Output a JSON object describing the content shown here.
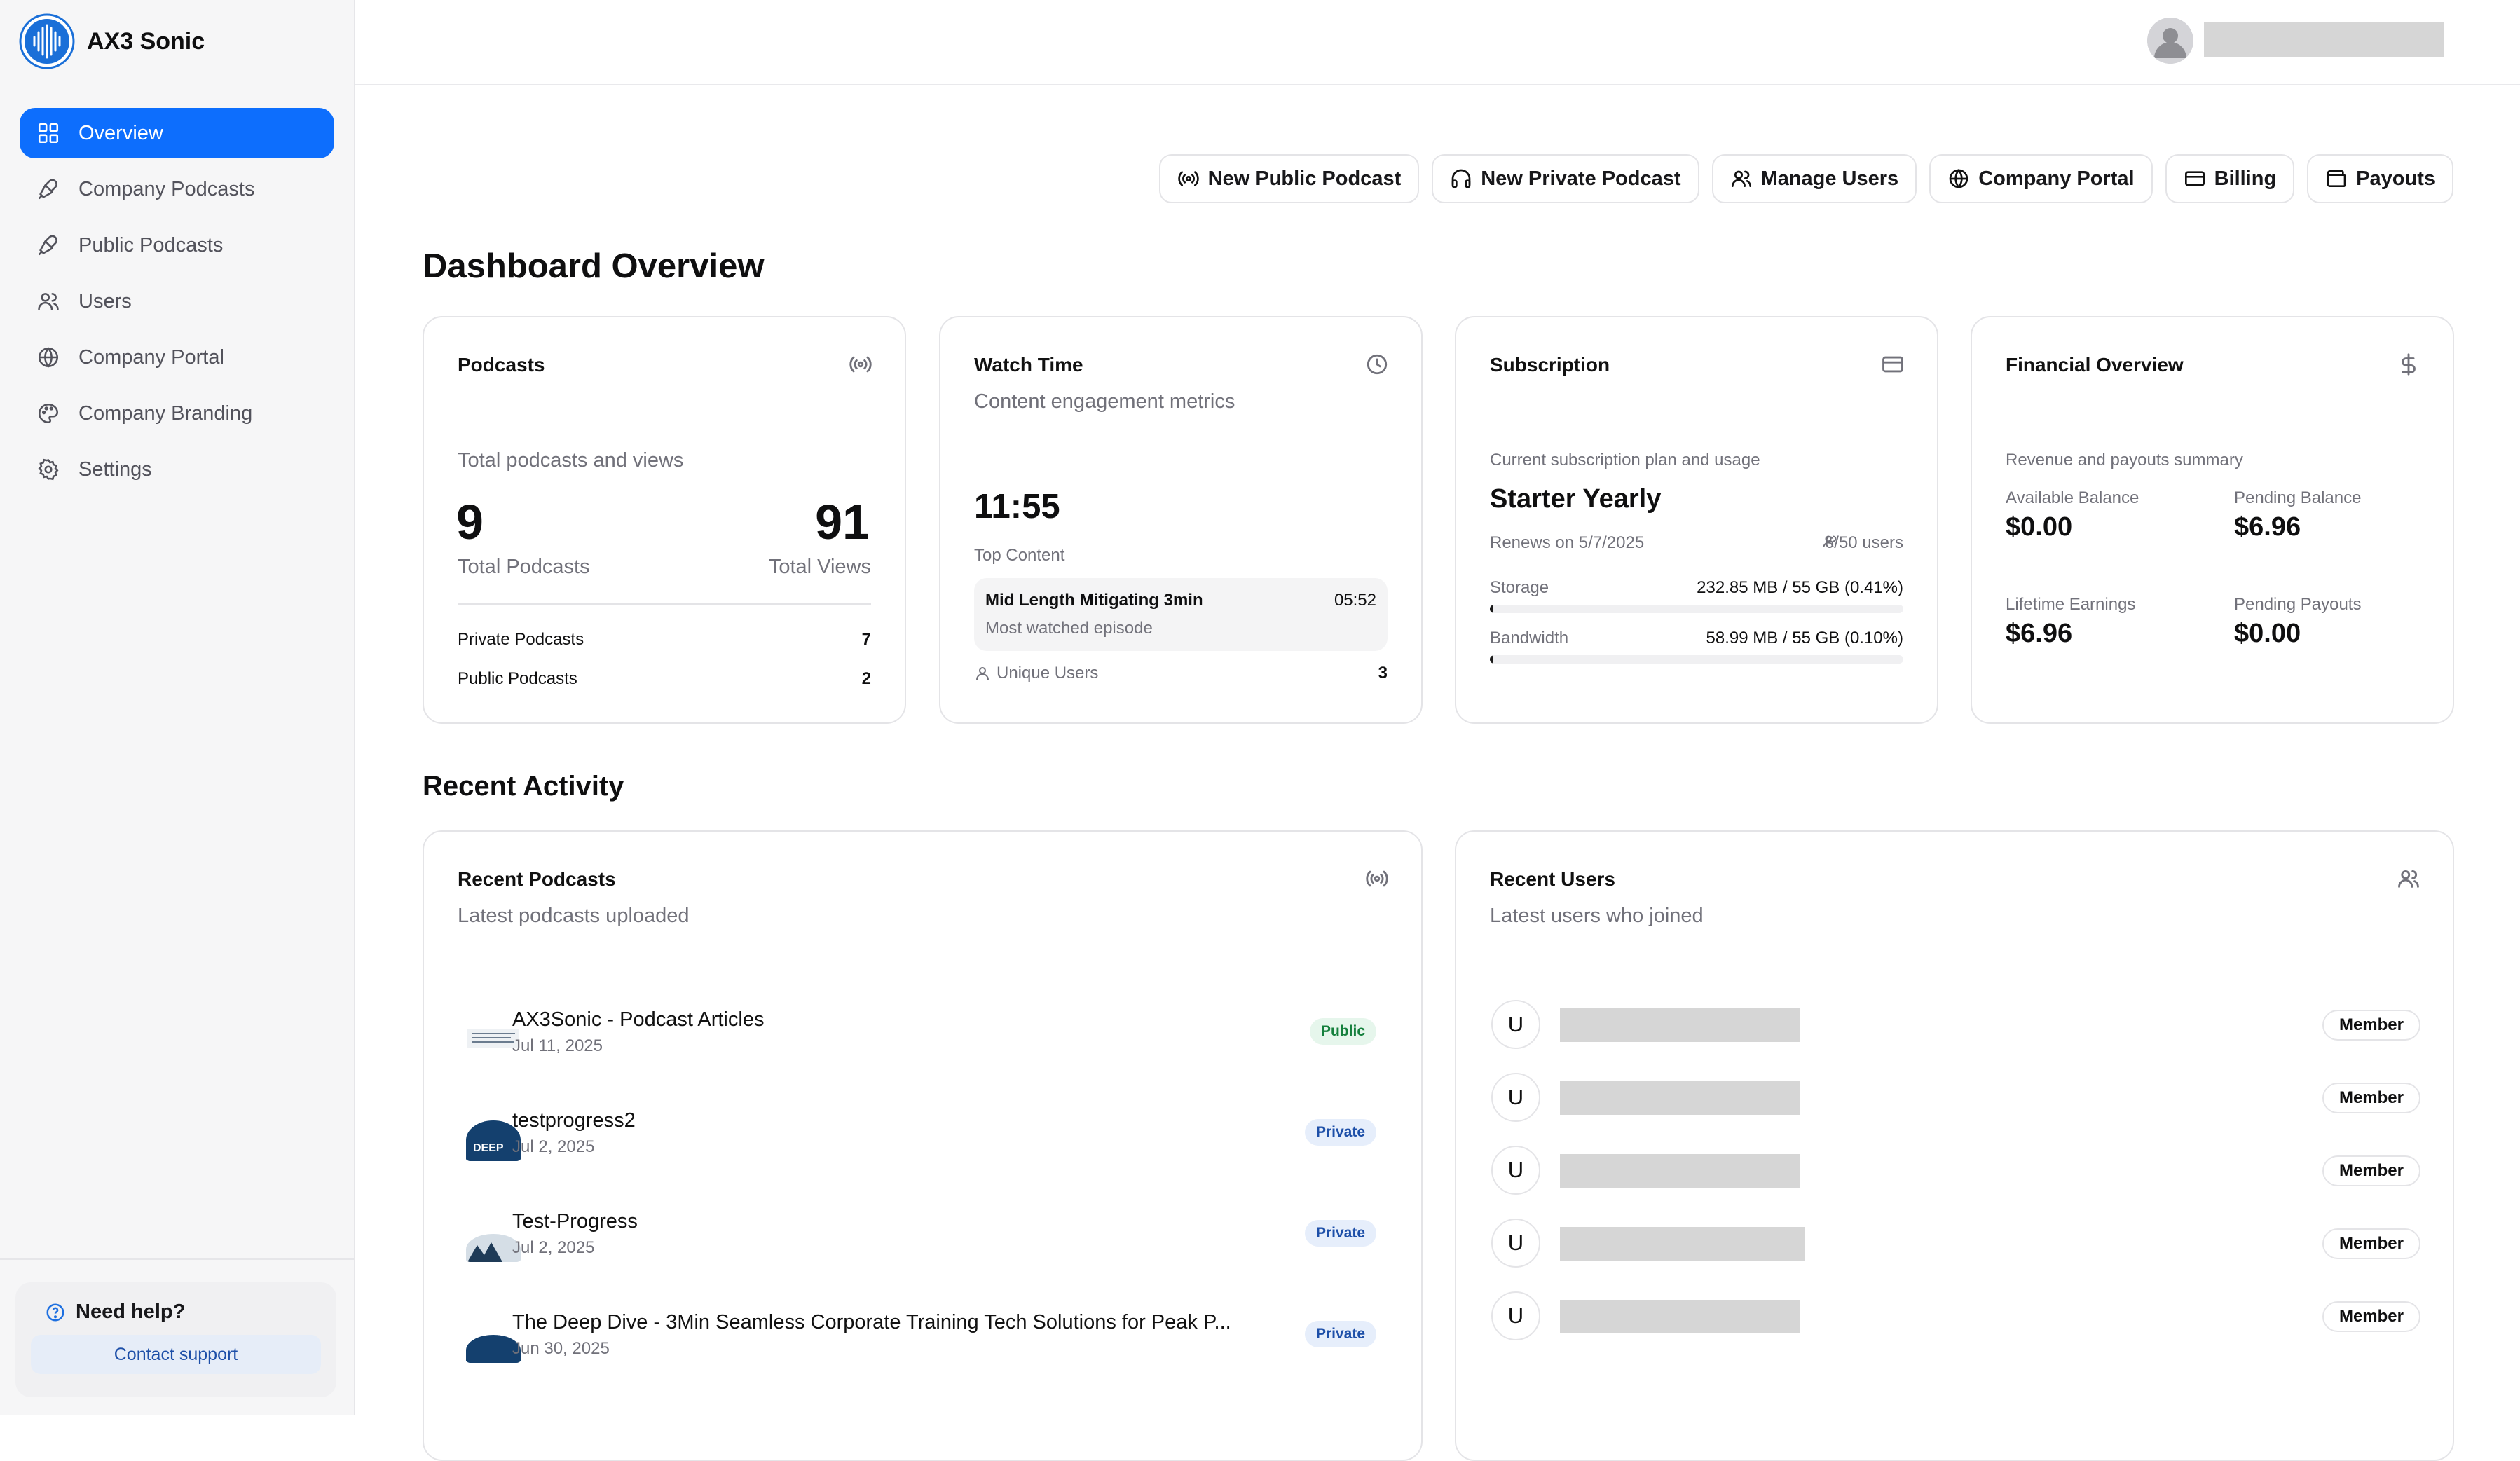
{
  "brand": {
    "name": "AX3 Sonic"
  },
  "sidebar": {
    "items": [
      {
        "label": "Overview",
        "icon": "grid-icon"
      },
      {
        "label": "Company Podcasts",
        "icon": "microphone-icon"
      },
      {
        "label": "Public Podcasts",
        "icon": "microphone-icon"
      },
      {
        "label": "Users",
        "icon": "users-icon"
      },
      {
        "label": "Company Portal",
        "icon": "globe-icon"
      },
      {
        "label": "Company Branding",
        "icon": "palette-icon"
      },
      {
        "label": "Settings",
        "icon": "gear-icon"
      }
    ],
    "help": {
      "title": "Need help?",
      "link": "Contact support"
    }
  },
  "actions": [
    "New Public Podcast",
    "New Private Podcast",
    "Manage Users",
    "Company Portal",
    "Billing",
    "Payouts"
  ],
  "page": {
    "title": "Dashboard Overview",
    "recent_title": "Recent Activity"
  },
  "podcasts_card": {
    "title": "Podcasts",
    "subtitle": "Total podcasts and views",
    "total_podcasts": "9",
    "total_podcasts_label": "Total Podcasts",
    "total_views": "91",
    "total_views_label": "Total Views",
    "private_label": "Private Podcasts",
    "private_value": "7",
    "public_label": "Public Podcasts",
    "public_value": "2"
  },
  "watch_card": {
    "title": "Watch Time",
    "subtitle": "Content engagement metrics",
    "time": "11:55",
    "top_content_label": "Top Content",
    "top_title": "Mid Length Mitigating 3min",
    "top_sub": "Most watched episode",
    "top_duration": "05:52",
    "unique_label": "Unique Users",
    "unique_value": "3"
  },
  "subscription_card": {
    "title": "Subscription",
    "subtitle": "Current subscription plan and usage",
    "plan": "Starter Yearly",
    "renews": "Renews on 5/7/2025",
    "users": "6/50 users",
    "storage_label": "Storage",
    "storage_value": "232.85 MB / 55 GB (0.41%)",
    "storage_pct": 0.41,
    "bandwidth_label": "Bandwidth",
    "bandwidth_value": "58.99 MB / 55 GB (0.10%)",
    "bandwidth_pct": 0.1
  },
  "financial_card": {
    "title": "Financial Overview",
    "subtitle": "Revenue and payouts summary",
    "available_label": "Available Balance",
    "available": "$0.00",
    "pending_label": "Pending Balance",
    "pending": "$6.96",
    "lifetime_label": "Lifetime Earnings",
    "lifetime": "$6.96",
    "payouts_label": "Pending Payouts",
    "payouts": "$0.00"
  },
  "recent_podcasts": {
    "title": "Recent Podcasts",
    "subtitle": "Latest podcasts uploaded",
    "items": [
      {
        "title": "AX3Sonic - Podcast Articles",
        "date": "Jul 11, 2025",
        "badge": "Public"
      },
      {
        "title": "testprogress2",
        "date": "Jul 2, 2025",
        "badge": "Private"
      },
      {
        "title": "Test-Progress",
        "date": "Jul 2, 2025",
        "badge": "Private"
      },
      {
        "title": "The Deep Dive - 3Min Seamless Corporate Training Tech Solutions for Peak P...",
        "date": "Jun 30, 2025",
        "badge": "Private"
      }
    ]
  },
  "recent_users": {
    "title": "Recent Users",
    "subtitle": "Latest users who joined",
    "items": [
      {
        "initial": "U",
        "role": "Member"
      },
      {
        "initial": "U",
        "role": "Member"
      },
      {
        "initial": "U",
        "role": "Member"
      },
      {
        "initial": "U",
        "role": "Member"
      },
      {
        "initial": "U",
        "role": "Member"
      }
    ]
  }
}
